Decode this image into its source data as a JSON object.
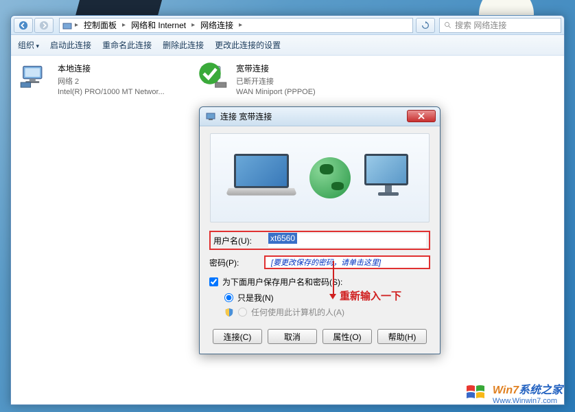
{
  "breadcrumb": {
    "items": [
      "控制面板",
      "网络和 Internet",
      "网络连接"
    ]
  },
  "search": {
    "placeholder": "搜索 网络连接"
  },
  "toolbar": {
    "organize": "组织",
    "start": "启动此连接",
    "rename": "重命名此连接",
    "delete": "删除此连接",
    "change": "更改此连接的设置"
  },
  "connections": {
    "local": {
      "name": "本地连接",
      "network": "网络 2",
      "device": "Intel(R) PRO/1000 MT Networ..."
    },
    "broadband": {
      "name": "宽带连接",
      "status": "已断开连接",
      "device": "WAN Miniport (PPPOE)"
    }
  },
  "dialog": {
    "title": "连接 宽带连接",
    "username_label": "用户名(U):",
    "username_value": "xt6560",
    "password_label": "密码(P):",
    "password_hint": "[要更改保存的密码，请单击这里]",
    "save_check": "为下面用户保存用户名和密码(S):",
    "radio_me": "只是我(N)",
    "radio_all": "任何使用此计算机的人(A)",
    "btn_connect": "连接(C)",
    "btn_cancel": "取消",
    "btn_props": "属性(O)",
    "btn_help": "帮助(H)"
  },
  "annotation": {
    "text": "重新输入一下"
  },
  "watermark": {
    "title_a": "Win7",
    "title_b": "系统之家",
    "url": "Www.Winwin7.com"
  }
}
